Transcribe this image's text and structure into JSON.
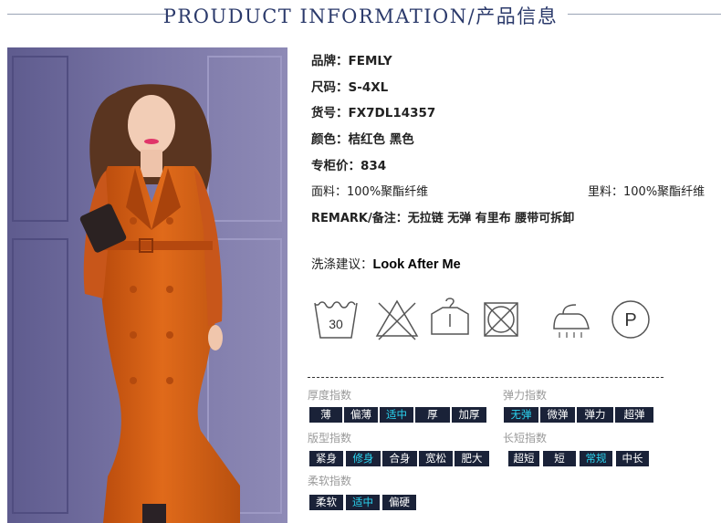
{
  "header": {
    "title": "PROUDUCT INFORMATION/产品信息"
  },
  "specs": {
    "brand": {
      "label": "品牌：",
      "value": "FEMLY"
    },
    "size": {
      "label": "尺码：",
      "value": "S-4XL"
    },
    "item_no": {
      "label": "货号：",
      "value": "FX7DL14357"
    },
    "color": {
      "label": "颜色：",
      "value": "桔红色 黑色"
    },
    "price": {
      "label": "专柜价：",
      "value": "834"
    },
    "fabric": {
      "label": "面料：",
      "value": "100%聚酯纤维"
    },
    "lining": {
      "label": "里料：",
      "value": "100%聚酯纤维"
    },
    "remark": {
      "label": "REMARK/备注：",
      "value": "无拉链 无弹 有里布 腰带可拆卸"
    },
    "wash": {
      "label": "洗涤建议：",
      "value": "Look After Me"
    }
  },
  "care_icons": [
    {
      "name": "wash-30-icon",
      "text": "30"
    },
    {
      "name": "no-bleach-icon"
    },
    {
      "name": "hang-dry-icon"
    },
    {
      "name": "no-tumble-dry-icon"
    },
    {
      "name": "iron-steam-icon"
    },
    {
      "name": "dry-clean-p-icon",
      "text": "P"
    }
  ],
  "indices": {
    "thickness": {
      "label": "厚度指数",
      "options": [
        "薄",
        "偏薄",
        "适中",
        "厚",
        "加厚"
      ],
      "selected": "适中"
    },
    "elasticity": {
      "label": "弹力指数",
      "options": [
        "无弹",
        "微弹",
        "弹力",
        "超弹"
      ],
      "selected": "无弹"
    },
    "fit": {
      "label": "版型指数",
      "options": [
        "紧身",
        "修身",
        "合身",
        "宽松",
        "肥大"
      ],
      "selected": "修身"
    },
    "length": {
      "label": "长短指数",
      "options": [
        "超短",
        "短",
        "常规",
        "中长"
      ],
      "selected": "常规"
    },
    "softness": {
      "label": "柔软指数",
      "options": [
        "柔软",
        "适中",
        "偏硬"
      ],
      "selected": "适中"
    }
  },
  "colors": {
    "tag_bg": "#1a2238",
    "tag_active_text": "#2ad4f0",
    "title": "#2b3a6b"
  }
}
